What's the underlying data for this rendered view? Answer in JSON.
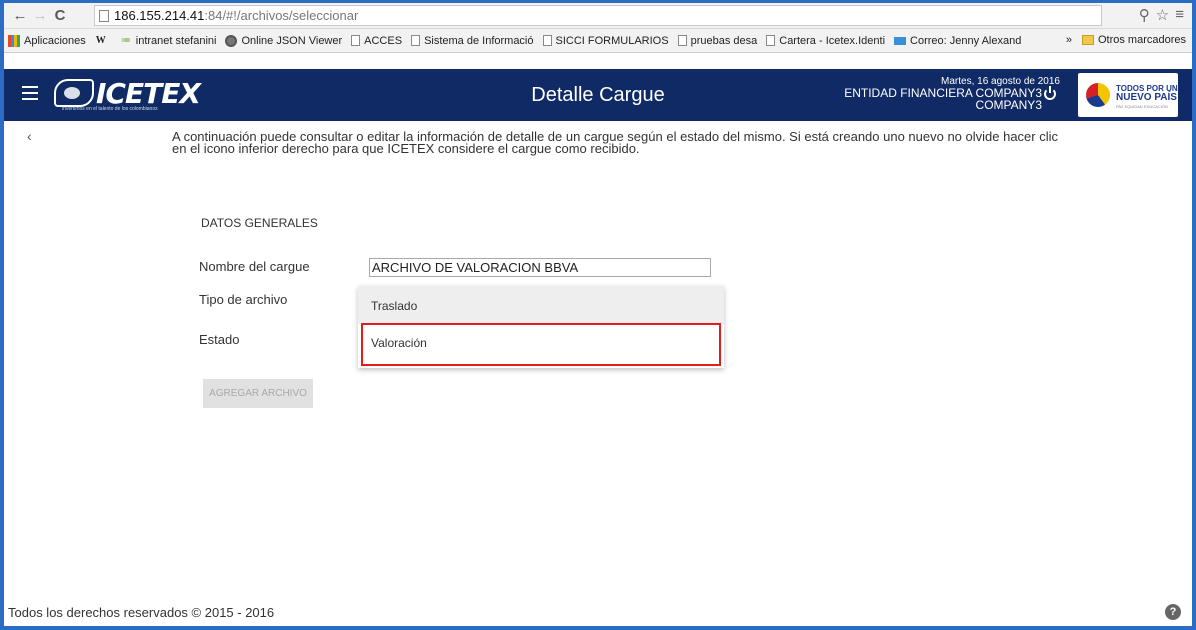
{
  "browser": {
    "url_host": "186.155.214.41",
    "url_path": ":84/#!/archivos/seleccionar"
  },
  "bookmarks": {
    "items": [
      {
        "label": "Aplicaciones",
        "icon": "apps-grid-icon"
      },
      {
        "label": "",
        "icon": "wikipedia-icon"
      },
      {
        "label": "intranet stefanini",
        "icon": "intranet-icon"
      },
      {
        "label": "Online JSON Viewer",
        "icon": "json-viewer-icon"
      },
      {
        "label": "ACCES",
        "icon": "page-icon"
      },
      {
        "label": "Sistema de Informació",
        "icon": "page-icon"
      },
      {
        "label": "SICCI FORMULARIOS",
        "icon": "page-icon"
      },
      {
        "label": "pruebas desa",
        "icon": "page-icon"
      },
      {
        "label": "Cartera - Icetex.Identi",
        "icon": "page-icon"
      },
      {
        "label": "Correo: Jenny Alexand",
        "icon": "mail-icon"
      }
    ],
    "more": "»",
    "other": "Otros marcadores"
  },
  "header": {
    "logo_text": "ICETEX",
    "logo_tagline": "invertimos en el talento de los colombianos",
    "title": "Detalle Cargue",
    "date": "Martes, 16 agosto de 2016",
    "entity": "ENTIDAD FINANCIERA COMPANY3",
    "user": "COMPANY3",
    "gov_logo_line1": "TODOS POR UN",
    "gov_logo_line2": "NUEVO PAÍS",
    "gov_logo_line3": "PAZ EQUIDAD EDUCACIÓN"
  },
  "content": {
    "intro": "A continuación puede consultar o editar la información de detalle de un cargue según el estado del mismo. Si está creando uno nuevo no olvide hacer clic en el icono inferior derecho para que ICETEX considere el cargue como recibido.",
    "section_title": "DATOS GENERALES",
    "fields": {
      "name_label": "Nombre del cargue",
      "name_value": "ARCHIVO DE VALORACION BBVA",
      "type_label": "Tipo de archivo",
      "status_label": "Estado"
    },
    "dropdown_options": [
      "Traslado",
      "Valoración"
    ],
    "add_button": "AGREGAR ARCHIVO"
  },
  "footer": {
    "copyright": "Todos los derechos reservados © 2015 - 2016"
  },
  "colors": {
    "header_bg": "#0f2a64",
    "highlight": "#e21b1b",
    "window_border": "#2b6cc4"
  }
}
